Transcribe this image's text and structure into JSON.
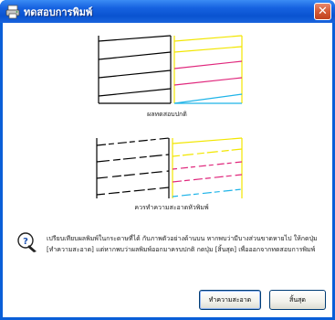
{
  "window": {
    "title": "ทดสอบการพิมพ์",
    "close_glyph": "✕"
  },
  "patterns": {
    "normal_caption": "ผลทดสอบปกติ",
    "clean_caption": "ควรทำความสะอาดหัวพิมพ์"
  },
  "message": {
    "text": "เปรียบเทียบผลพิมพ์ในกระดาษที่ได้ กับภาพตัวอย่างด้านบน หากพบว่ามีบางส่วนขาดหายไป ให้กดปุ่ม [ทำความสะอาด] แต่หากพบว่าผลพิมพ์ออกมาครบปกติ กดปุ่ม [สิ้นสุด] เพื่อออกจากทดสอบการพิมพ์"
  },
  "buttons": {
    "clean_label": "ทำความสะอาด",
    "finish_label": "สิ้นสุด"
  },
  "colors": {
    "black": "#000000",
    "yellow": "#f2e600",
    "magenta": "#e0287d",
    "cyan": "#1fb4e8",
    "title_blue": "#0a53d0",
    "close_red": "#c0421f"
  }
}
